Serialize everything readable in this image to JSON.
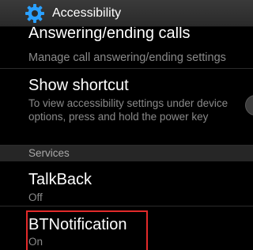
{
  "action_bar": {
    "title": "Accessibility",
    "icon": "gear-icon",
    "icon_color": "#2aa0ff"
  },
  "rows": {
    "answering": {
      "title": "Answering/ending calls",
      "summary": "Manage call answering/ending settings"
    },
    "shortcut": {
      "title": "Show shortcut",
      "summary": "To view accessibility settings under device options, press and hold the power key",
      "toggle_state": "off"
    },
    "talkback": {
      "title": "TalkBack",
      "summary": "Off"
    },
    "btnotification": {
      "title": "BTNotification",
      "summary": "On"
    }
  },
  "section_services": "Services",
  "colors": {
    "background": "#000000",
    "highlight": "#e22a2a",
    "title_text": "#ffffff",
    "summary_text": "#8a8a8a"
  }
}
